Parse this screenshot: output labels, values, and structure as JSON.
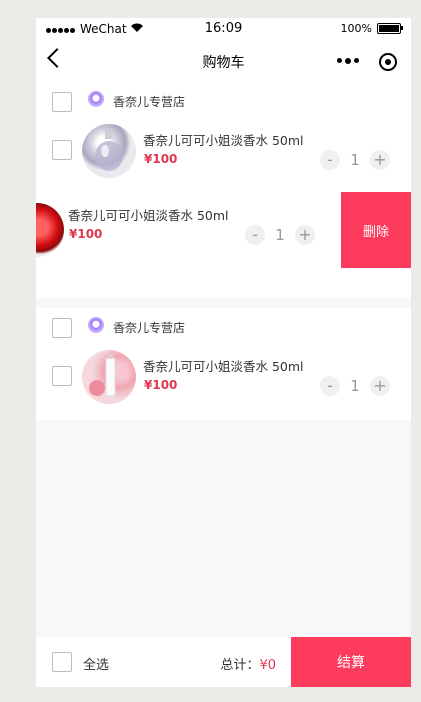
{
  "status": {
    "carrier": "WeChat",
    "time": "16:09",
    "battery": "100%"
  },
  "navbar": {
    "title": "购物车"
  },
  "groups": [
    {
      "shop_name": "香奈儿专营店",
      "items": [
        {
          "name": "香奈儿可可小姐淡香水 50ml",
          "price": "¥100",
          "qty": "1",
          "minus": "-",
          "plus": "+"
        },
        {
          "name": "香奈儿可可小姐淡香水 50ml",
          "price": "¥100",
          "qty": "1",
          "minus": "-",
          "plus": "+",
          "delete_label": "删除"
        }
      ]
    },
    {
      "shop_name": "香奈儿专营店",
      "items": [
        {
          "name": "香奈儿可可小姐淡香水 50ml",
          "price": "¥100",
          "qty": "1",
          "minus": "-",
          "plus": "+"
        }
      ]
    }
  ],
  "footer": {
    "select_all": "全选",
    "total_label": "总计：",
    "total_value": "¥0",
    "checkout": "结算"
  },
  "colors": {
    "accent": "#fd3b5c",
    "price": "#e2364f"
  }
}
